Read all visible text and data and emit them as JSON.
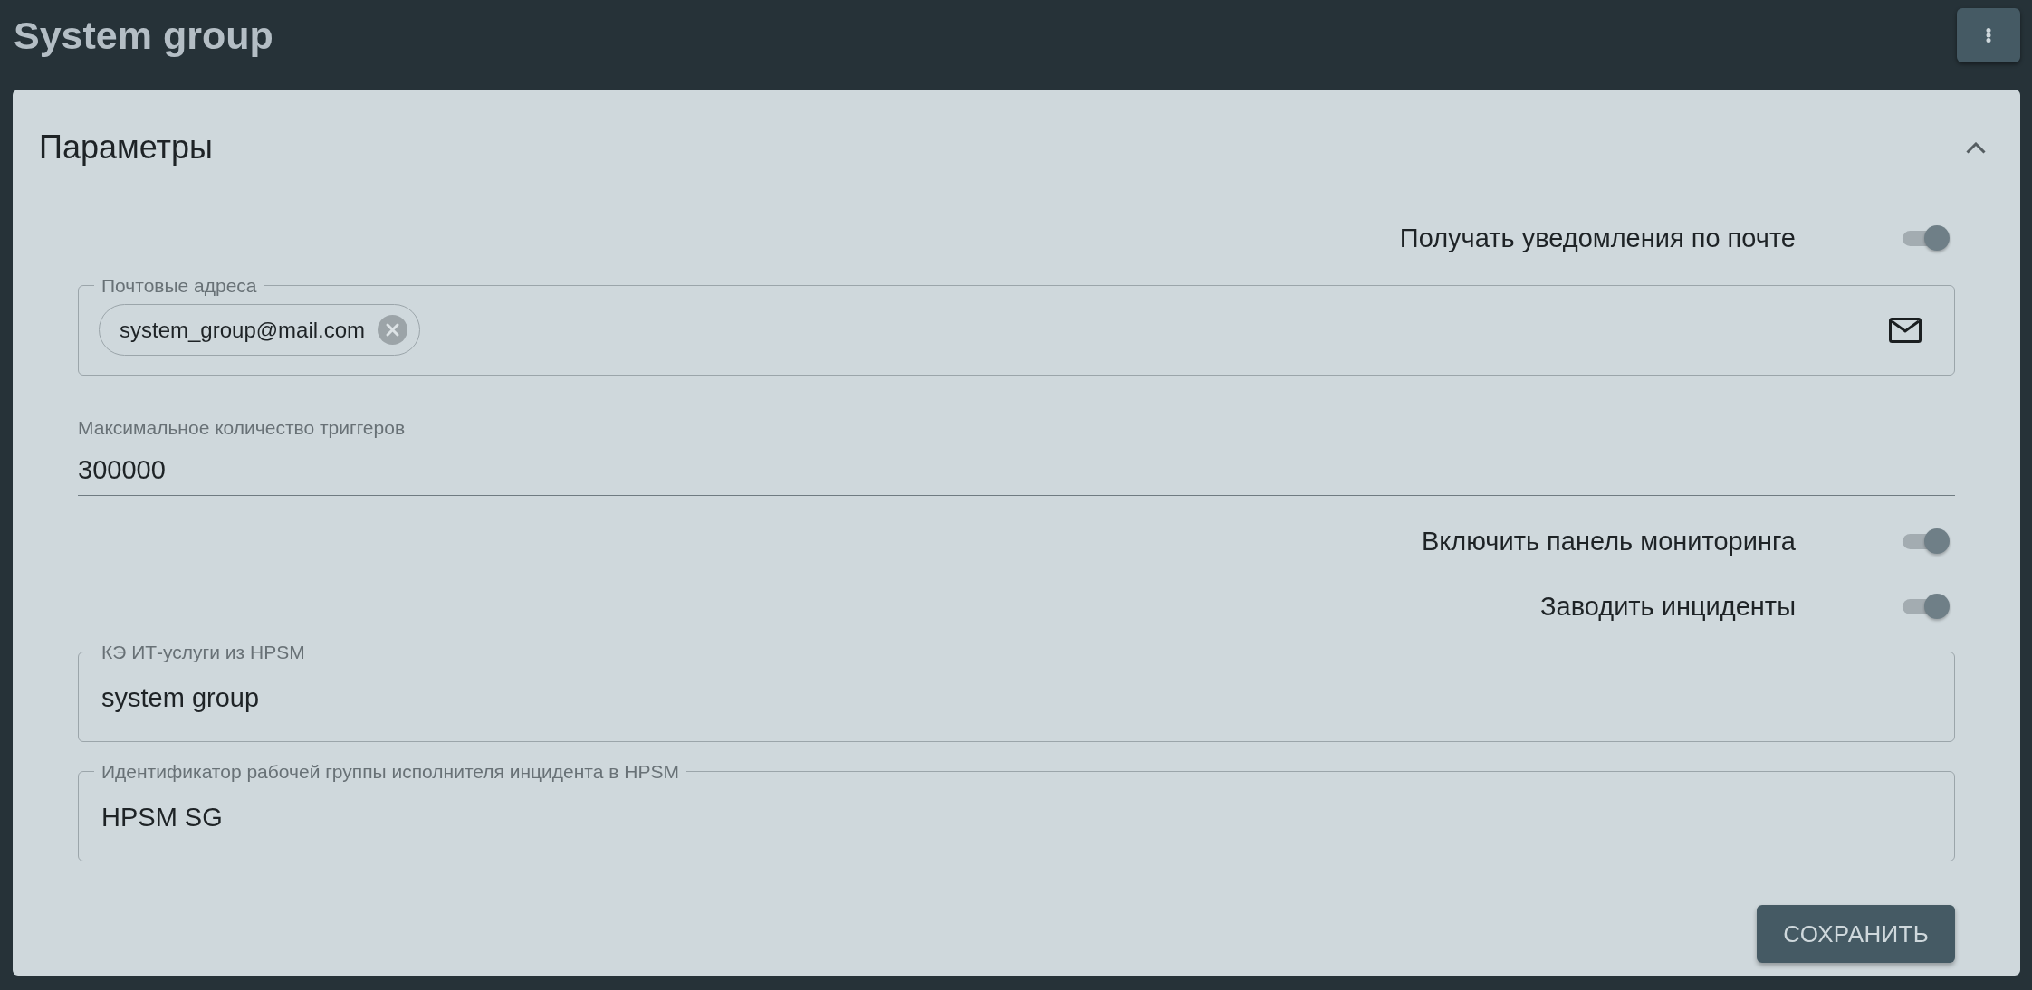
{
  "header": {
    "title": "System group"
  },
  "panel": {
    "title": "Параметры",
    "expanded": true,
    "fields": [
      {
        "kind": "toggle",
        "label": "Получать уведомления по почте",
        "on": true
      },
      {
        "kind": "chips",
        "label": "Почтовые адреса",
        "chips": [
          {
            "label": "system_group@mail.com"
          }
        ]
      },
      {
        "kind": "underlined",
        "label": "Максимальное количество триггеров",
        "value": "300000"
      },
      {
        "kind": "toggle",
        "label": "Включить панель мониторинга",
        "on": true
      },
      {
        "kind": "toggle",
        "label": "Заводить инциденты",
        "on": true
      },
      {
        "kind": "outlined",
        "label": "КЭ ИТ-услуги из HPSM",
        "value": "system group"
      },
      {
        "kind": "outlined",
        "label": "Идентификатор рабочей группы исполнителя инцидента в HPSM",
        "value": "HPSM SG"
      }
    ],
    "save_button": "СОХРАНИТЬ"
  }
}
